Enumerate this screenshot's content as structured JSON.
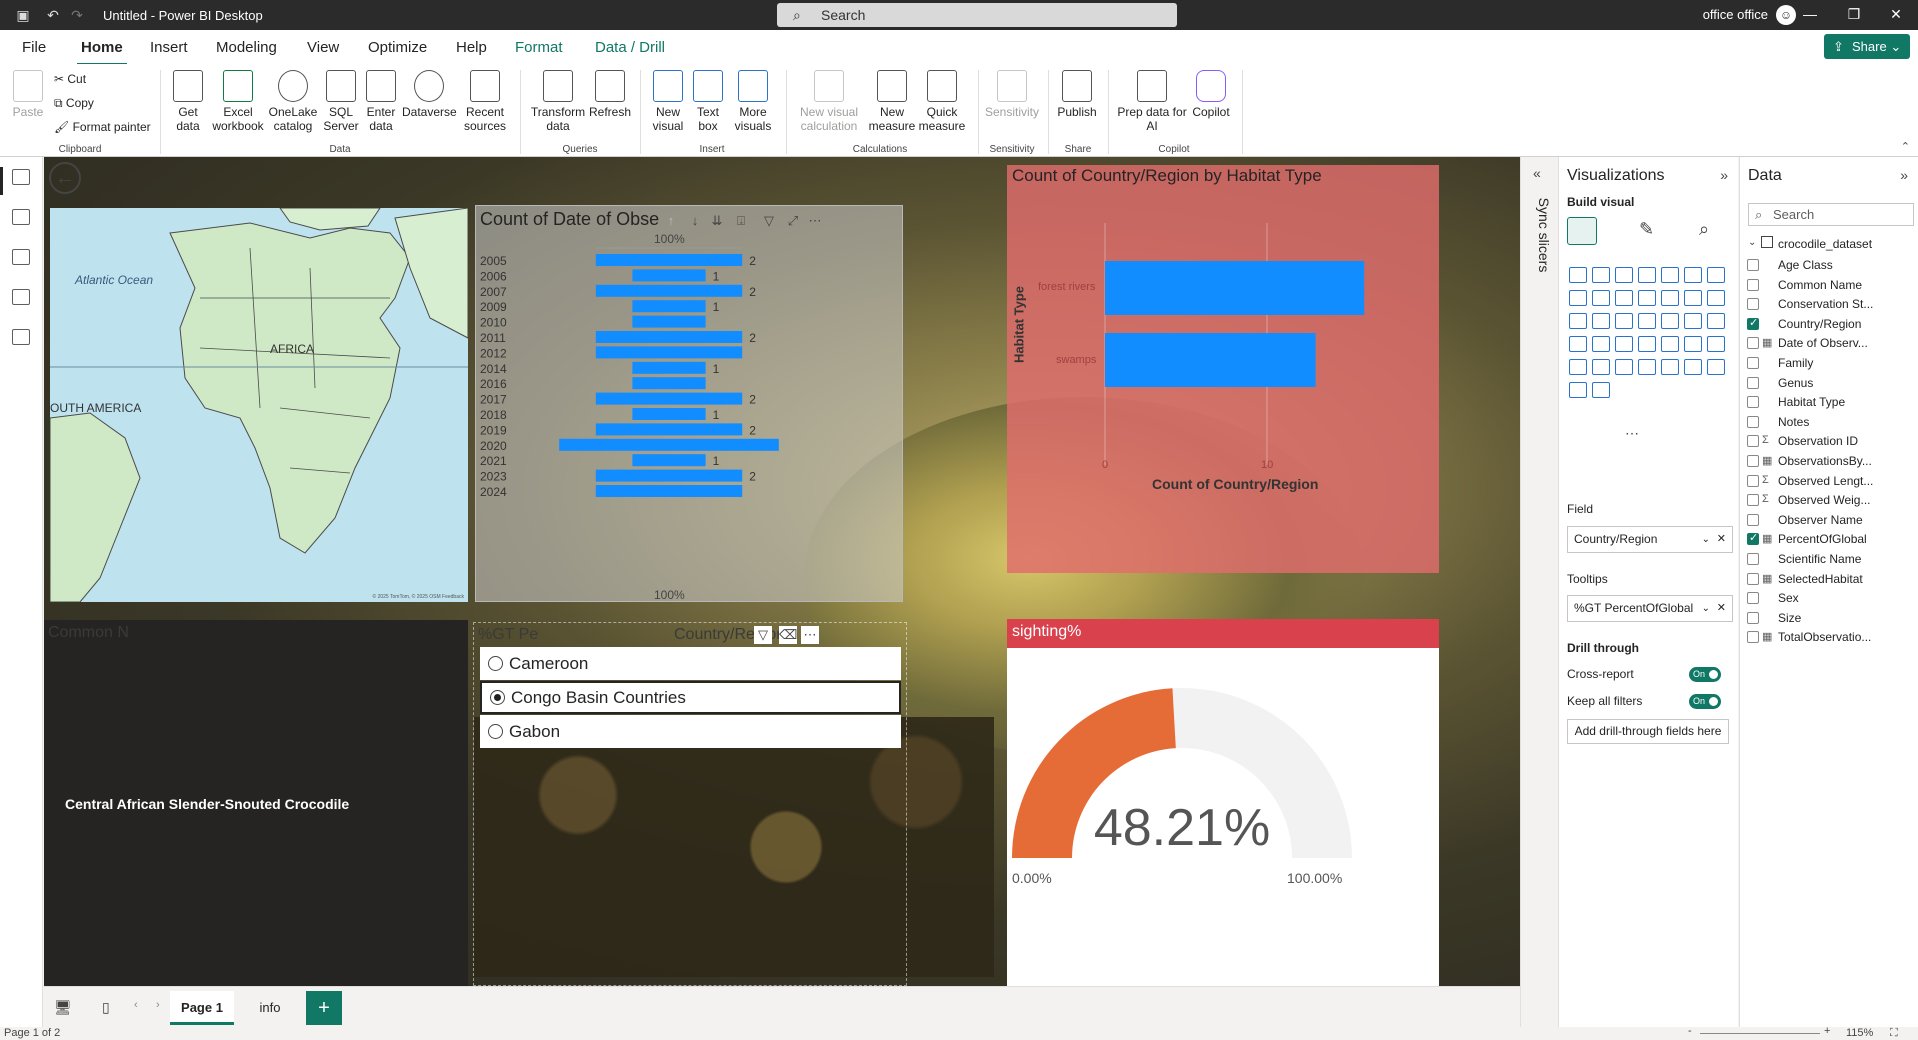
{
  "app": {
    "title": "Untitled - Power BI Desktop",
    "search_placeholder": "Search",
    "user": "office office",
    "share_label": "Share"
  },
  "menu": [
    "File",
    "Home",
    "Insert",
    "Modeling",
    "View",
    "Optimize",
    "Help",
    "Format",
    "Data / Drill"
  ],
  "ribbon": {
    "clipboard": {
      "paste": "Paste",
      "cut": "Cut",
      "copy": "Copy",
      "format_painter": "Format painter",
      "label": "Clipboard"
    },
    "data": {
      "get_data": "Get data",
      "excel": "Excel workbook",
      "onelake": "OneLake catalog",
      "sql": "SQL Server",
      "enter": "Enter data",
      "dataverse": "Dataverse",
      "recent": "Recent sources",
      "label": "Data"
    },
    "queries": {
      "transform": "Transform data",
      "refresh": "Refresh",
      "label": "Queries"
    },
    "insert": {
      "new_visual": "New visual",
      "text_box": "Text box",
      "more": "More visuals",
      "label": "Insert"
    },
    "calculations": {
      "new_visual_calc": "New visual calculation",
      "new_measure": "New measure",
      "quick_measure": "Quick measure",
      "label": "Calculations"
    },
    "sensitivity": {
      "btn": "Sensitivity",
      "label": "Sensitivity"
    },
    "share": {
      "publish": "Publish",
      "label": "Share"
    },
    "copilot": {
      "prep": "Prep data for AI",
      "copilot": "Copilot",
      "label": "Copilot"
    }
  },
  "map": {
    "ocean": "Atlantic Ocean",
    "africa": "AFRICA",
    "south_america": "OUTH AMERICA",
    "credit": "© 2025 TomTom, © 2025 OSM  Feedback"
  },
  "count_chart": {
    "title": "Count of Date of Observat",
    "top_axis": "100%",
    "bottom_axis": "100%"
  },
  "chart_data": [
    {
      "type": "bar",
      "title": "Count of Date of Observat",
      "categories": [
        "2005",
        "2006",
        "2007",
        "2009",
        "2010",
        "2011",
        "2012",
        "2014",
        "2016",
        "2017",
        "2018",
        "2019",
        "2020",
        "2021",
        "2023",
        "2024"
      ],
      "values": [
        2,
        1,
        2,
        1,
        1,
        2,
        2,
        1,
        1,
        2,
        1,
        2,
        3,
        1,
        2,
        2
      ],
      "labels": [
        "2",
        "1",
        "2",
        "1",
        "",
        "2",
        "",
        "1",
        "",
        "2",
        "1",
        "2",
        "",
        "1",
        "2",
        ""
      ],
      "color": "#118dff"
    },
    {
      "type": "bar",
      "title": "Count of Country/Region by Habitat Type",
      "categories": [
        "forest rivers",
        "swamps"
      ],
      "values": [
        16,
        13
      ],
      "xlabel": "Count of Country/Region",
      "ylabel": "Habitat Type",
      "ticks": [
        "0",
        "10"
      ],
      "xlim": [
        0,
        16.5
      ],
      "color": "#118dff"
    }
  ],
  "habitat": {
    "title": "Count of Country/Region by Habitat Type",
    "xlabel": "Count of Country/Region",
    "ylabel": "Habitat Type",
    "tick0": "0",
    "tick10": "10",
    "cat1": "forest rivers",
    "cat2": "swamps"
  },
  "black_card": {
    "faint": "Common N",
    "name": "Central African Slender-Snouted Crocodile"
  },
  "slicer": {
    "faint": "%GT Pe",
    "faint2": "Country/Region",
    "items": [
      "Cameroon",
      "Congo Basin Countries",
      "Gabon"
    ],
    "selected": 1
  },
  "gauge": {
    "title": "sighting%",
    "value_text": "48.21%",
    "min": "0.00%",
    "max": "100.00%",
    "value": 0.4821,
    "fill": "#e66c37",
    "track": "#f2f2f2"
  },
  "pages": {
    "page1": "Page 1",
    "page2": "info",
    "status": "Page 1 of 2",
    "zoom": "115%"
  },
  "sync_slicers": "Sync slicers",
  "viz_pane": {
    "title": "Visualizations",
    "build": "Build visual",
    "field_label": "Field",
    "field_value": "Country/Region",
    "tooltips_label": "Tooltips",
    "tooltips_value": "%GT PercentOfGlobal",
    "drill_label": "Drill through",
    "cross_report": "Cross-report",
    "keep_filters": "Keep all filters",
    "toggle_on": "On",
    "add_drill": "Add drill-through fields here"
  },
  "data_pane": {
    "title": "Data",
    "search": "Search",
    "dataset": "crocodile_dataset",
    "fields": [
      {
        "name": "Age Class",
        "checked": false,
        "type": ""
      },
      {
        "name": "Common Name",
        "checked": false,
        "type": ""
      },
      {
        "name": "Conservation St...",
        "checked": false,
        "type": ""
      },
      {
        "name": "Country/Region",
        "checked": true,
        "type": ""
      },
      {
        "name": "Date of Observ...",
        "checked": false,
        "type": "table"
      },
      {
        "name": "Family",
        "checked": false,
        "type": ""
      },
      {
        "name": "Genus",
        "checked": false,
        "type": ""
      },
      {
        "name": "Habitat Type",
        "checked": false,
        "type": ""
      },
      {
        "name": "Notes",
        "checked": false,
        "type": ""
      },
      {
        "name": "Observation ID",
        "checked": false,
        "type": "sigma"
      },
      {
        "name": "ObservationsBy...",
        "checked": false,
        "type": "table"
      },
      {
        "name": "Observed Lengt...",
        "checked": false,
        "type": "sigma"
      },
      {
        "name": "Observed Weig...",
        "checked": false,
        "type": "sigma"
      },
      {
        "name": "Observer Name",
        "checked": false,
        "type": ""
      },
      {
        "name": "PercentOfGlobal",
        "checked": true,
        "type": "table"
      },
      {
        "name": "Scientific Name",
        "checked": false,
        "type": ""
      },
      {
        "name": "SelectedHabitat",
        "checked": false,
        "type": "table"
      },
      {
        "name": "Sex",
        "checked": false,
        "type": ""
      },
      {
        "name": "Size",
        "checked": false,
        "type": ""
      },
      {
        "name": "TotalObservatio...",
        "checked": false,
        "type": "table"
      }
    ]
  }
}
